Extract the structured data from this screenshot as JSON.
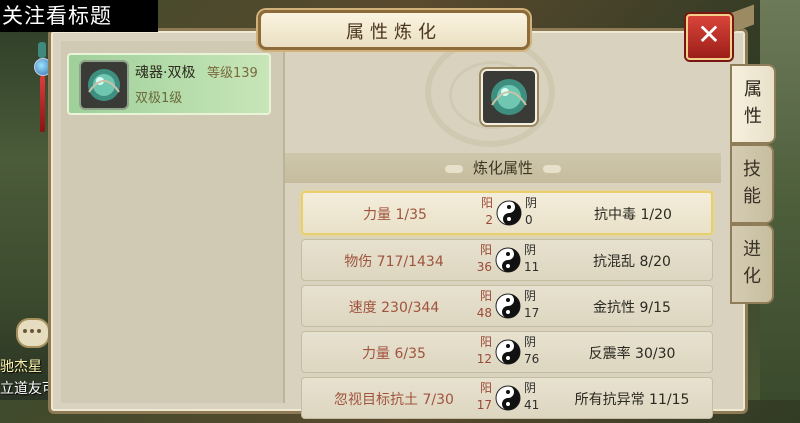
{
  "overlay_caption": "关注看标题",
  "window": {
    "title": "属性炼化"
  },
  "npc": {
    "name": "驰杰星",
    "line2": "立道友可"
  },
  "item": {
    "name": "魂器·双极",
    "level": "等级139",
    "sub": "双极1级"
  },
  "section": {
    "title": "炼化属性"
  },
  "rows": [
    {
      "left": "力量 1/35",
      "yang_label": "阳",
      "yang_value": "2",
      "yin_label": "阴",
      "yin_value": "0",
      "right": "抗中毒 1/20",
      "selected": true
    },
    {
      "left": "物伤 717/1434",
      "yang_label": "阳",
      "yang_value": "36",
      "yin_label": "阴",
      "yin_value": "11",
      "right": "抗混乱 8/20",
      "selected": false
    },
    {
      "left": "速度 230/344",
      "yang_label": "阳",
      "yang_value": "48",
      "yin_label": "阴",
      "yin_value": "17",
      "right": "金抗性 9/15",
      "selected": false
    },
    {
      "left": "力量 6/35",
      "yang_label": "阳",
      "yang_value": "12",
      "yin_label": "阴",
      "yin_value": "76",
      "right": "反震率 30/30",
      "selected": false
    },
    {
      "left": "忽视目标抗土 7/30",
      "yang_label": "阳",
      "yang_value": "17",
      "yin_label": "阴",
      "yin_value": "41",
      "right": "所有抗异常 11/15",
      "selected": false
    }
  ],
  "tabs": [
    {
      "label_top": "属",
      "label_bottom": "性",
      "active": true
    },
    {
      "label_top": "技",
      "label_bottom": "能",
      "active": false
    },
    {
      "label_top": "进",
      "label_bottom": "化",
      "active": false
    }
  ],
  "close_symbol": "✕",
  "colors": {
    "selected_border": "#e9cf6b",
    "close_red": "#c8352c",
    "item_card_green": "#9fd09a"
  },
  "icons": [
    "taiji-icon",
    "soul-orb-icon",
    "close-icon",
    "chat-icon"
  ]
}
